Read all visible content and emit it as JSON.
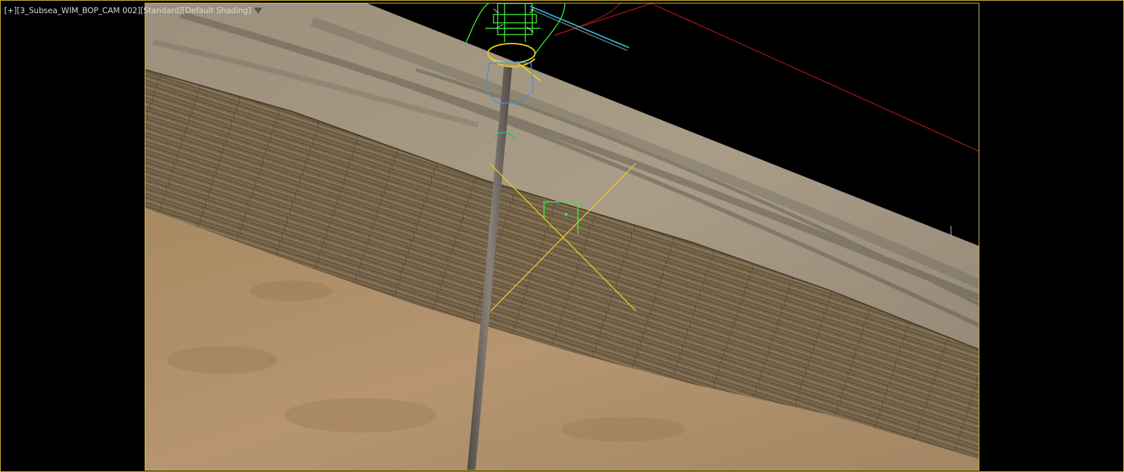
{
  "viewport": {
    "label_segments": [
      {
        "id": "menu",
        "text": "[+]"
      },
      {
        "id": "camera",
        "text": "[3_Subsea_WIM_BOP_CAM 002]"
      },
      {
        "id": "renderer",
        "text": "[Standard]"
      },
      {
        "id": "shading",
        "text": "[Default Shading]"
      }
    ],
    "filter_icon": "funnel-icon"
  },
  "colors": {
    "frame": "#d4b93a",
    "background": "#000000",
    "seabed_top": "#a79a86",
    "rock_layer": "#7a6a50",
    "sand_layer": "#b8976c",
    "pipe": "#6b6560",
    "target_cross": "#e8c826",
    "wireframe_green": "#38e838",
    "wireframe_blue": "#4a8fd6",
    "gizmo_red": "#b01818",
    "gizmo_cyan": "#3ea8c8"
  }
}
